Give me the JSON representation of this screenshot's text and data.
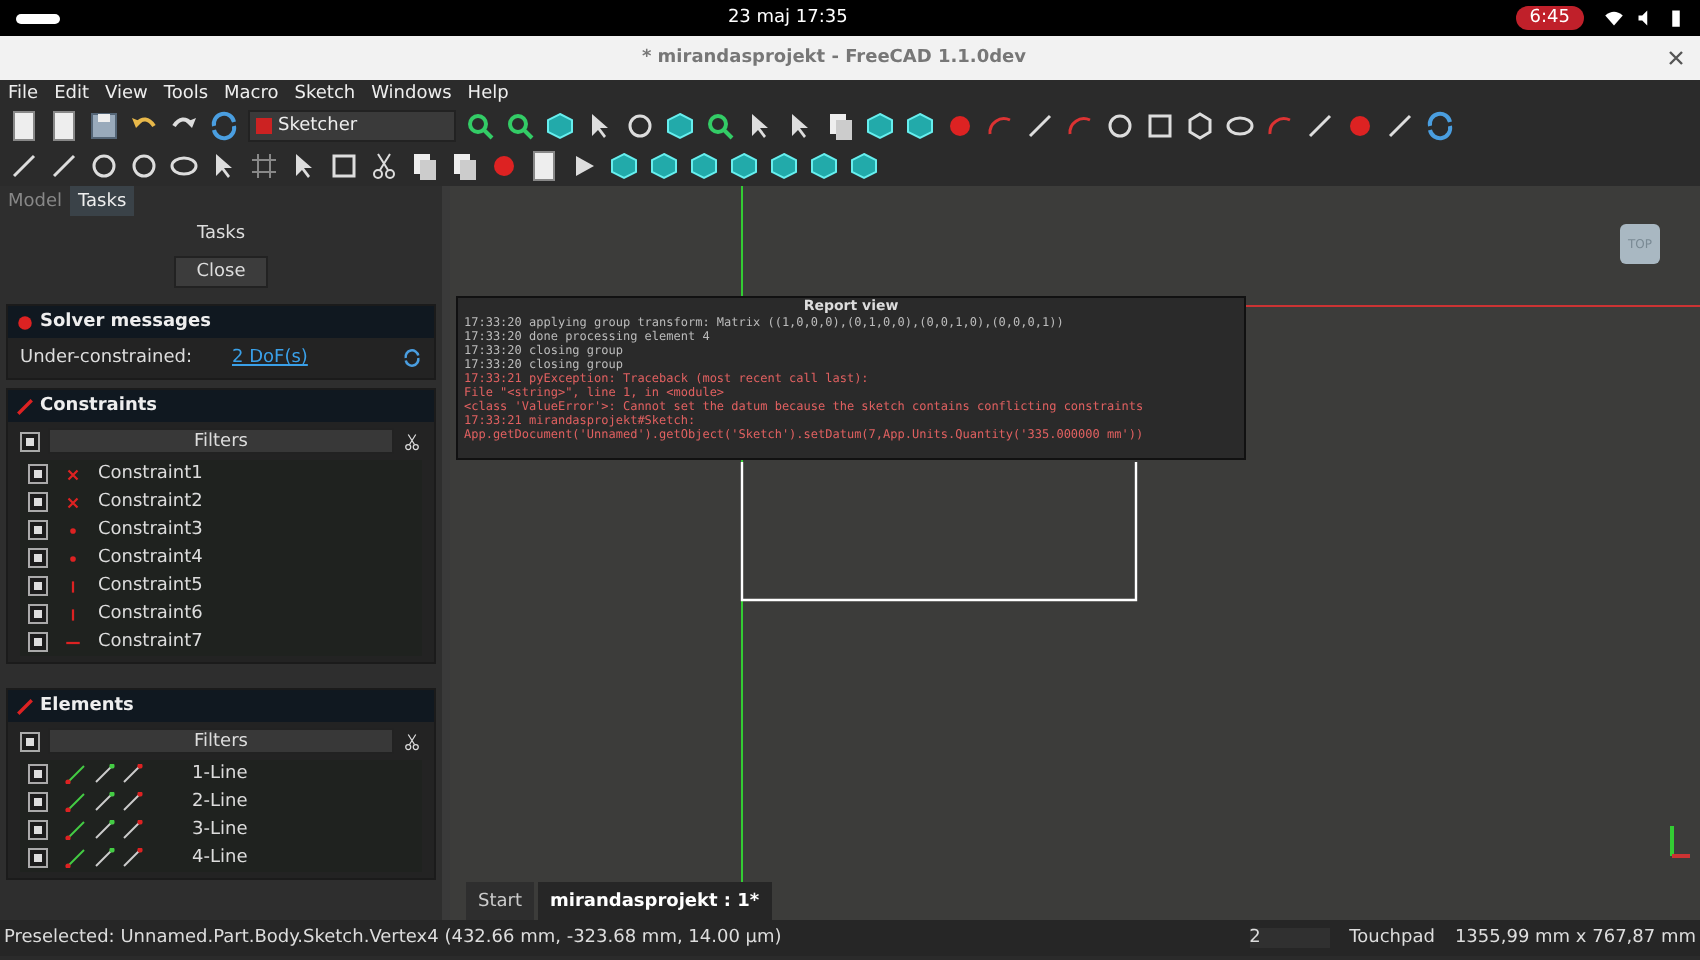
{
  "system_bar": {
    "clock": "23 maj  17:35",
    "battery_pill": "6:45"
  },
  "window": {
    "title": "* mirandasprojekt - FreeCAD 1.1.0dev"
  },
  "menu": [
    "File",
    "Edit",
    "View",
    "Tools",
    "Macro",
    "Sketch",
    "Windows",
    "Help"
  ],
  "toolbar": {
    "workbench": "Sketcher"
  },
  "panel_tabs": [
    {
      "label": "Model",
      "selected": false
    },
    {
      "label": "Tasks",
      "selected": true
    }
  ],
  "tasks": {
    "title": "Tasks",
    "close_button": "Close",
    "solver": {
      "title": "Solver messages",
      "label": "Under-constrained:",
      "link": "2 DoF(s)"
    },
    "constraints": {
      "title": "Constraints",
      "filter": "Filters",
      "all_checked": true,
      "items": [
        {
          "label": "Constraint1",
          "kind": "coincident",
          "checked": true
        },
        {
          "label": "Constraint2",
          "kind": "coincident",
          "checked": true
        },
        {
          "label": "Constraint3",
          "kind": "point",
          "checked": true
        },
        {
          "label": "Constraint4",
          "kind": "point",
          "checked": true
        },
        {
          "label": "Constraint5",
          "kind": "vertical",
          "checked": true
        },
        {
          "label": "Constraint6",
          "kind": "vertical",
          "checked": true
        },
        {
          "label": "Constraint7",
          "kind": "horizontal",
          "checked": true
        }
      ]
    },
    "elements": {
      "title": "Elements",
      "filter": "Filters",
      "all_checked": true,
      "items": [
        {
          "label": "1-Line",
          "checked": true
        },
        {
          "label": "2-Line",
          "checked": true
        },
        {
          "label": "3-Line",
          "checked": true
        },
        {
          "label": "4-Line",
          "checked": true
        }
      ]
    }
  },
  "report_view": {
    "title": "Report view",
    "lines": [
      {
        "text": "17:33:20  applying group transform: Matrix ((1,0,0,0),(0,1,0,0),(0,0,1,0),(0,0,0,1))",
        "kind": "log"
      },
      {
        "text": "17:33:20  done processing element 4",
        "kind": "log"
      },
      {
        "text": "17:33:20  closing group",
        "kind": "log"
      },
      {
        "text": "17:33:20  closing group",
        "kind": "log"
      },
      {
        "text": "17:33:21  pyException: Traceback (most recent call last):",
        "kind": "error"
      },
      {
        "text": "  File \"<string>\", line 1, in <module>",
        "kind": "error"
      },
      {
        "text": "<class 'ValueError'>: Cannot set the datum because the sketch contains conflicting constraints",
        "kind": "error"
      },
      {
        "text": "17:33:21  mirandasprojekt#Sketch:",
        "kind": "error"
      },
      {
        "text": "App.getDocument('Unnamed').getObject('Sketch').setDatum(7,App.Units.Quantity('335.000000 mm'))",
        "kind": "error"
      }
    ]
  },
  "nav_cube": {
    "face": "TOP"
  },
  "document_tabs": [
    {
      "label": "Start",
      "selected": false
    },
    {
      "label": "mirandasprojekt : 1*",
      "selected": true
    }
  ],
  "status_bar": {
    "message": "Preselected: Unnamed.Part.Body.Sketch.Vertex4 (432.66 mm, -323.68 mm, 14.00 µm)",
    "count": "2",
    "navigation": "Touchpad",
    "dimensions": "1355,99 mm x 767,87 mm"
  }
}
